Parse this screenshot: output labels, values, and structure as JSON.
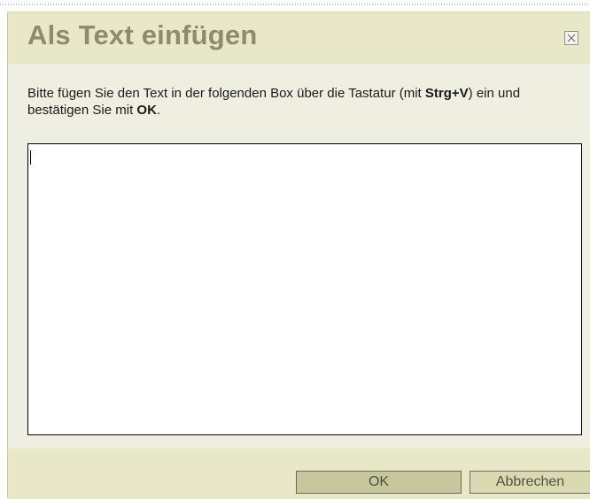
{
  "dialog": {
    "title": "Als Text einfügen",
    "close_icon": "close-icon",
    "instruction": {
      "part1": "Bitte fügen Sie den Text in der folgenden Box über die Tastatur (mit ",
      "shortcut": "Strg+V",
      "part2": ") ein und bestätigen Sie mit ",
      "ok_word": "OK",
      "part3": "."
    },
    "textarea_value": "",
    "buttons": {
      "ok_label": "OK",
      "cancel_label": "Abbrechen"
    }
  },
  "colors": {
    "title_text": "#8c8c6b",
    "dialog_bg": "#efefe1",
    "bar_bg": "#e8e8c8",
    "ok_button_bg": "#c7c79e",
    "cancel_button_bg": "#dadab2"
  }
}
